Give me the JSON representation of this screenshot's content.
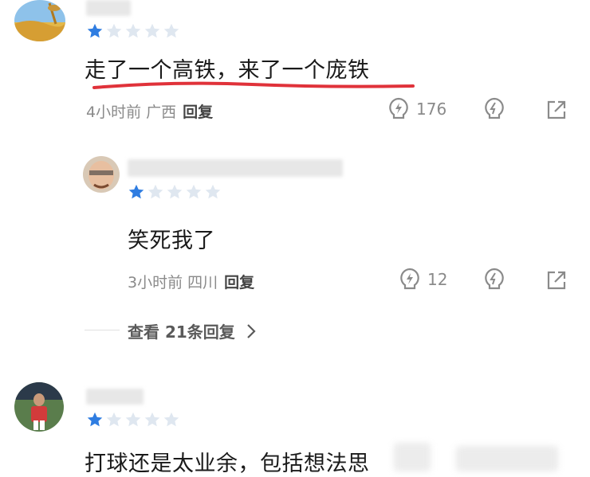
{
  "comments": [
    {
      "rating": 1,
      "text": "走了一个高铁，来了一个庞铁",
      "time": "4小时前",
      "location": "广西",
      "reply_label": "回复",
      "likes": "176"
    },
    {
      "rating": 1,
      "text": "笑死我了",
      "time": "3小时前",
      "location": "四川",
      "reply_label": "回复",
      "likes": "12",
      "view_replies": "查看 21条回复"
    },
    {
      "rating": 1,
      "text": "打球还是太业余，包括想法思"
    }
  ],
  "colors": {
    "star_active": "#2f7de1",
    "star_inactive": "#dfe7f0",
    "underline": "#e0323a"
  },
  "icons": [
    "like-icon",
    "dislike-icon",
    "share-icon",
    "chevron-right-icon"
  ]
}
